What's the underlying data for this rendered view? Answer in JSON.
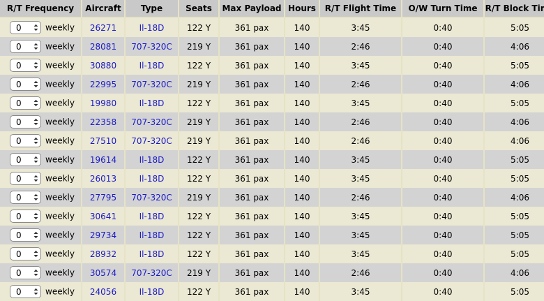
{
  "headers": [
    "R/T Frequency",
    "Aircraft",
    "Type",
    "Seats",
    "Max Payload",
    "Hours",
    "R/T Flight Time",
    "O/W Turn Time",
    "R/T Block Time"
  ],
  "rows": [
    {
      "freq": "0",
      "unit": "weekly",
      "aircraft": "26271",
      "type": "Il-18D",
      "seats": "122 Y",
      "payload": "361 pax",
      "hours": "140",
      "flight": "3:45",
      "turn": "0:40",
      "block": "5:05"
    },
    {
      "freq": "0",
      "unit": "weekly",
      "aircraft": "28081",
      "type": "707-320C",
      "seats": "219 Y",
      "payload": "361 pax",
      "hours": "140",
      "flight": "2:46",
      "turn": "0:40",
      "block": "4:06"
    },
    {
      "freq": "0",
      "unit": "weekly",
      "aircraft": "30880",
      "type": "Il-18D",
      "seats": "122 Y",
      "payload": "361 pax",
      "hours": "140",
      "flight": "3:45",
      "turn": "0:40",
      "block": "5:05"
    },
    {
      "freq": "0",
      "unit": "weekly",
      "aircraft": "22995",
      "type": "707-320C",
      "seats": "219 Y",
      "payload": "361 pax",
      "hours": "140",
      "flight": "2:46",
      "turn": "0:40",
      "block": "4:06"
    },
    {
      "freq": "0",
      "unit": "weekly",
      "aircraft": "19980",
      "type": "Il-18D",
      "seats": "122 Y",
      "payload": "361 pax",
      "hours": "140",
      "flight": "3:45",
      "turn": "0:40",
      "block": "5:05"
    },
    {
      "freq": "0",
      "unit": "weekly",
      "aircraft": "22358",
      "type": "707-320C",
      "seats": "219 Y",
      "payload": "361 pax",
      "hours": "140",
      "flight": "2:46",
      "turn": "0:40",
      "block": "4:06"
    },
    {
      "freq": "0",
      "unit": "weekly",
      "aircraft": "27510",
      "type": "707-320C",
      "seats": "219 Y",
      "payload": "361 pax",
      "hours": "140",
      "flight": "2:46",
      "turn": "0:40",
      "block": "4:06"
    },
    {
      "freq": "0",
      "unit": "weekly",
      "aircraft": "19614",
      "type": "Il-18D",
      "seats": "122 Y",
      "payload": "361 pax",
      "hours": "140",
      "flight": "3:45",
      "turn": "0:40",
      "block": "5:05"
    },
    {
      "freq": "0",
      "unit": "weekly",
      "aircraft": "26013",
      "type": "Il-18D",
      "seats": "122 Y",
      "payload": "361 pax",
      "hours": "140",
      "flight": "3:45",
      "turn": "0:40",
      "block": "5:05"
    },
    {
      "freq": "0",
      "unit": "weekly",
      "aircraft": "27795",
      "type": "707-320C",
      "seats": "219 Y",
      "payload": "361 pax",
      "hours": "140",
      "flight": "2:46",
      "turn": "0:40",
      "block": "4:06"
    },
    {
      "freq": "0",
      "unit": "weekly",
      "aircraft": "30641",
      "type": "Il-18D",
      "seats": "122 Y",
      "payload": "361 pax",
      "hours": "140",
      "flight": "3:45",
      "turn": "0:40",
      "block": "5:05"
    },
    {
      "freq": "0",
      "unit": "weekly",
      "aircraft": "29734",
      "type": "Il-18D",
      "seats": "122 Y",
      "payload": "361 pax",
      "hours": "140",
      "flight": "3:45",
      "turn": "0:40",
      "block": "5:05"
    },
    {
      "freq": "0",
      "unit": "weekly",
      "aircraft": "28932",
      "type": "Il-18D",
      "seats": "122 Y",
      "payload": "361 pax",
      "hours": "140",
      "flight": "3:45",
      "turn": "0:40",
      "block": "5:05"
    },
    {
      "freq": "0",
      "unit": "weekly",
      "aircraft": "30574",
      "type": "707-320C",
      "seats": "219 Y",
      "payload": "361 pax",
      "hours": "140",
      "flight": "2:46",
      "turn": "0:40",
      "block": "4:06"
    },
    {
      "freq": "0",
      "unit": "weekly",
      "aircraft": "24056",
      "type": "Il-18D",
      "seats": "122 Y",
      "payload": "361 pax",
      "hours": "140",
      "flight": "3:45",
      "turn": "0:40",
      "block": "5:05"
    }
  ],
  "colors": {
    "background": "#e6e3c6",
    "header": "#c9c9c9",
    "row_alt": "#d3d3d3",
    "link": "#1a1acc"
  },
  "icons": {
    "select_arrows": "updown-chevron-icon"
  }
}
